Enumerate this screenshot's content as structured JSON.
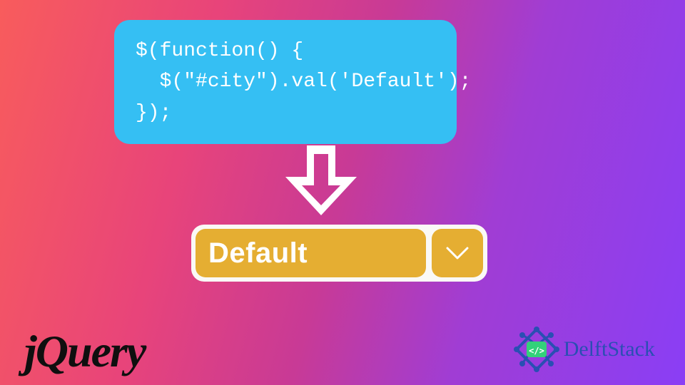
{
  "code": {
    "line1": "$(function() {",
    "line2": "  $(\"#city\").val('Default');",
    "line3": "});"
  },
  "select": {
    "value": "Default"
  },
  "logos": {
    "jquery": "jQuery",
    "delft": "DelftStack"
  },
  "icons": {
    "arrow_down": "arrow-down",
    "chevron_down": "chevron-down",
    "code_glyph": "</>"
  },
  "colors": {
    "code_bg": "#35BFF3",
    "select_bg": "#E5AE32",
    "select_outer": "#FAF9F6",
    "jquery_text": "#0f0f0f",
    "delft_text": "#2a4fb3"
  }
}
